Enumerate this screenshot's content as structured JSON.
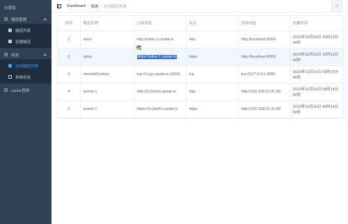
{
  "sidebar": {
    "logo_label": "仪表盘",
    "items": [
      {
        "label": "隧道管理",
        "type": "group"
      },
      {
        "label": "隧道列表",
        "type": "sub"
      },
      {
        "label": "创建隧道",
        "type": "sub"
      },
      {
        "label": "状态",
        "type": "group"
      },
      {
        "label": "在线隧道列表",
        "type": "sub",
        "active": true
      },
      {
        "label": "系统状态",
        "type": "sub"
      },
      {
        "label": "cpolar官网",
        "type": "link"
      }
    ]
  },
  "navbar": {
    "breadcrumb": [
      "Dashboard",
      "状态",
      "在线隧道列表"
    ]
  },
  "table": {
    "headers": [
      "序列",
      "隧道名称",
      "公网地址",
      "协议",
      "本地地址",
      "创建时间"
    ],
    "rows": [
      [
        "1",
        "odoo",
        "http://odoo-1.cpolar.io",
        "http",
        "http://localhost:8069",
        "2023年10月19日 10时13分44秒"
      ],
      [
        "2",
        "odoo",
        "https://odoo-1.cpolar.io",
        "https",
        "http://localhost:8069",
        "2023年10月19日 10时13分44秒"
      ],
      [
        "3",
        "remoteDesktop",
        "tcp://1.tcp.cpolar.io:10331",
        "tcp",
        "tcp://127.0.0.1:3389",
        "2023年10月19日 09时16分46秒"
      ],
      [
        "4",
        "tunnel-1",
        "http://1c2acfcf.cpolar.io",
        "http",
        "http://192.168.31.91:80",
        "2023年10月19日 09时14分50秒"
      ],
      [
        "5",
        "tunnel-1",
        "https://1c2acfcf.cpolar.io",
        "https",
        "http://192.168.31.91:80",
        "2023年10月19日 09时14分50秒"
      ]
    ]
  },
  "colors": {
    "sidebar_bg": "#304156",
    "sidebar_sub_bg": "#1f2d3d",
    "accent": "#409eff",
    "selection": "#3367d6"
  }
}
